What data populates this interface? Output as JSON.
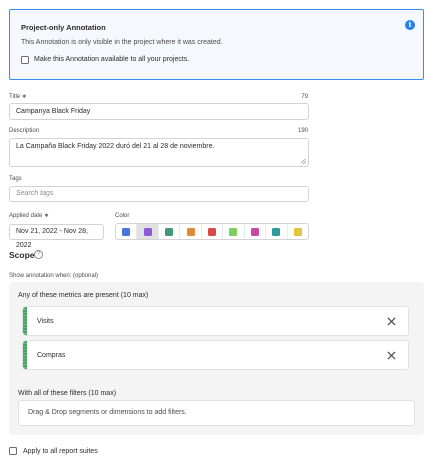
{
  "info": {
    "title": "Project-only Annotation",
    "text": "This Annotation is only visible in the project where it was created.",
    "checkbox_label": "Make this Annotation available to all your projects.",
    "icon": "info-icon"
  },
  "title_field": {
    "label": "Title",
    "required_mark": "✱",
    "count": "79",
    "value": "Campanya Black Friday"
  },
  "description_field": {
    "label": "Description",
    "count": "190",
    "value": "La Campaña Black Friday 2022 duró del 21 al 28 de noviembre."
  },
  "tags_field": {
    "label": "Tags",
    "placeholder": "Search tags"
  },
  "date_field": {
    "label": "Applied date",
    "required_mark": "✱",
    "value": "Nov 21, 2022 - Nov 28, 2022"
  },
  "color": {
    "label": "Color",
    "swatches": [
      "#4a73d8",
      "#8b5bd6",
      "#3f9b72",
      "#e08a34",
      "#d64a4a",
      "#7ccf5e",
      "#c84aa4",
      "#2f9a9a",
      "#e2c43a"
    ],
    "selected_index": 1
  },
  "scope": {
    "heading": "Scope",
    "help_icon": "?",
    "show_when": "Show annotation when: (optional)",
    "metrics_title": "Any of these metrics are present (10 max)",
    "metrics": [
      "Visits",
      "Compras"
    ],
    "filters_title": "With all of these filters (10 max)",
    "filters_placeholder": "Drag & Drop segments or dimensions to add filters."
  },
  "apply_all": {
    "label": "Apply to all report suites"
  }
}
